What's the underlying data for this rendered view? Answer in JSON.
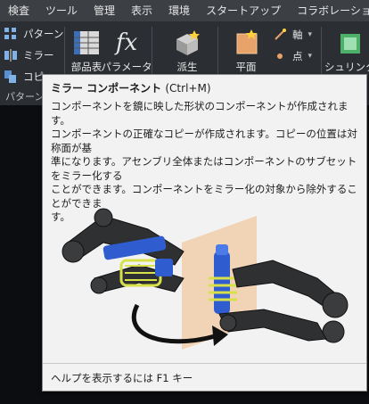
{
  "menubar": {
    "items": [
      "検査",
      "ツール",
      "管理",
      "表示",
      "環境",
      "スタートアップ",
      "コラボレーション"
    ]
  },
  "ribbon": {
    "pattern_panel": {
      "items": [
        "パターン",
        "ミラー",
        "コピー"
      ],
      "label": "パターン"
    },
    "bom_label": "部品表",
    "parameters_label": "パラメータ",
    "derive_label": "派生",
    "plane_label": "平面",
    "axis_label": "軸",
    "point_label": "点",
    "shrinkwrap_label": "シュリンクラ"
  },
  "tooltip": {
    "title": "ミラー コンポーネント",
    "shortcut": "(Ctrl+M)",
    "summary": "コンポーネントを鏡に映した形状のコンポーネントが作成されます。",
    "detail_lines": [
      "コンポーネントの正確なコピーが作成されます。コピーの位置は対称面が基",
      "準になります。アセンブリ全体またはコンポーネントのサブセットをミラー化する",
      "ことができます。コンポーネントをミラー化の対象から除外することができま",
      "す。"
    ],
    "footer": "ヘルプを表示するには F1 キー"
  },
  "colors": {
    "menubar_bg": "#3c3f44",
    "ribbon_bg": "#2b2e33",
    "tooltip_bg": "#f2f2f2",
    "spring_yellow": "#d8e04a",
    "shock_blue": "#2f5dd0",
    "mirror_plane": "#f0c8a0"
  }
}
